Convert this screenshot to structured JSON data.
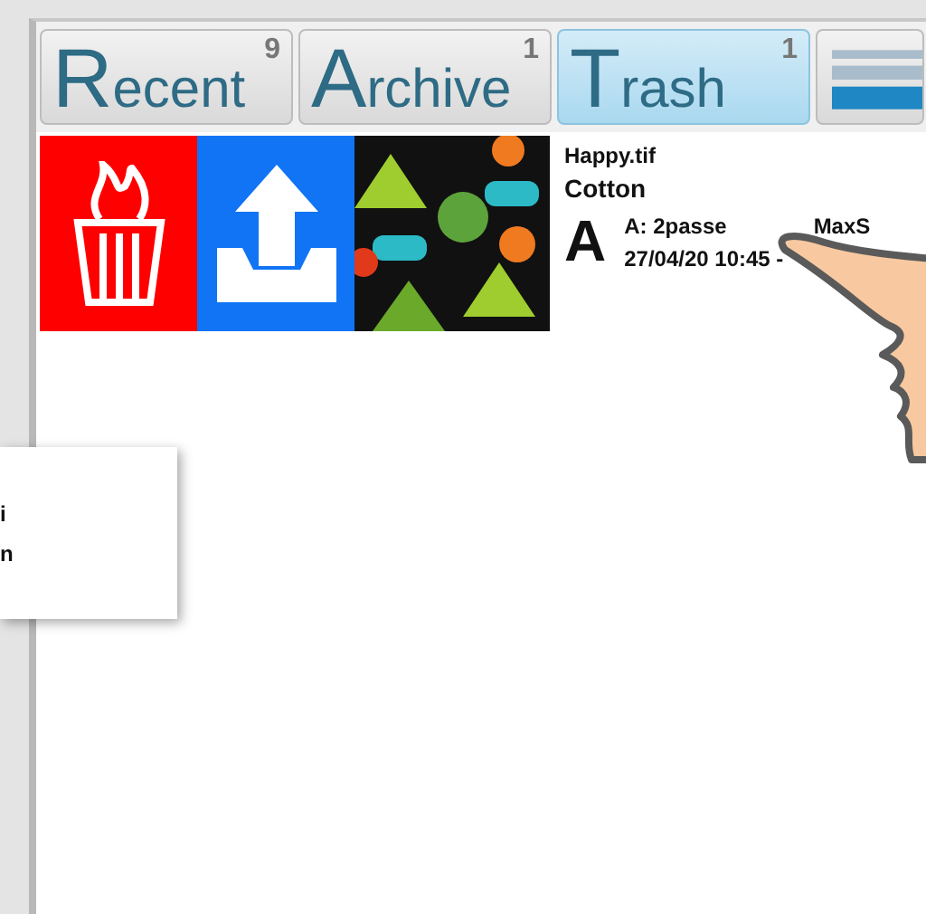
{
  "tabs": [
    {
      "label": "Recent",
      "count": "9",
      "selected": false
    },
    {
      "label": "Archive",
      "count": "1",
      "selected": false
    },
    {
      "label": "Trash",
      "count": "1",
      "selected": true
    }
  ],
  "item": {
    "file": "Happy.tif",
    "material": "Cotton",
    "letter": "A",
    "detail_start": "A: 2passe",
    "detail_end": "MaxS",
    "date": "27/04/20 10:45 -"
  },
  "popup": {
    "lines": [
      "i",
      "n"
    ]
  }
}
